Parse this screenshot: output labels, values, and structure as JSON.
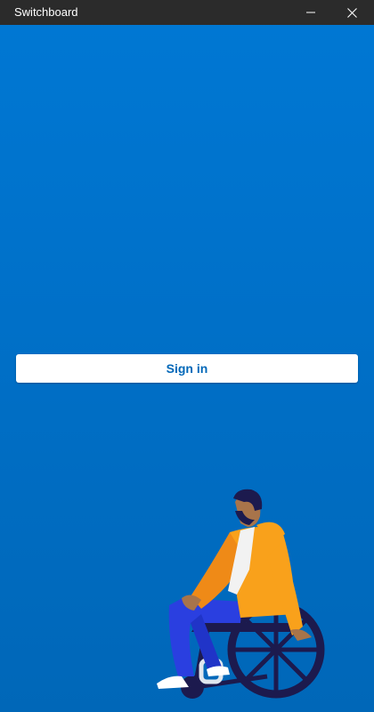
{
  "window": {
    "title": "Switchboard",
    "controls": [
      "minimize-icon",
      "close-icon"
    ]
  },
  "colors": {
    "titlebar": "#2b2b2b",
    "background_top": "#0078d4",
    "background_bottom": "#0067b8",
    "button_background": "#ffffff",
    "button_text": "#0067b8"
  },
  "main": {
    "sign_in_label": "Sign in",
    "illustration": "person-in-wheelchair-illustration"
  }
}
